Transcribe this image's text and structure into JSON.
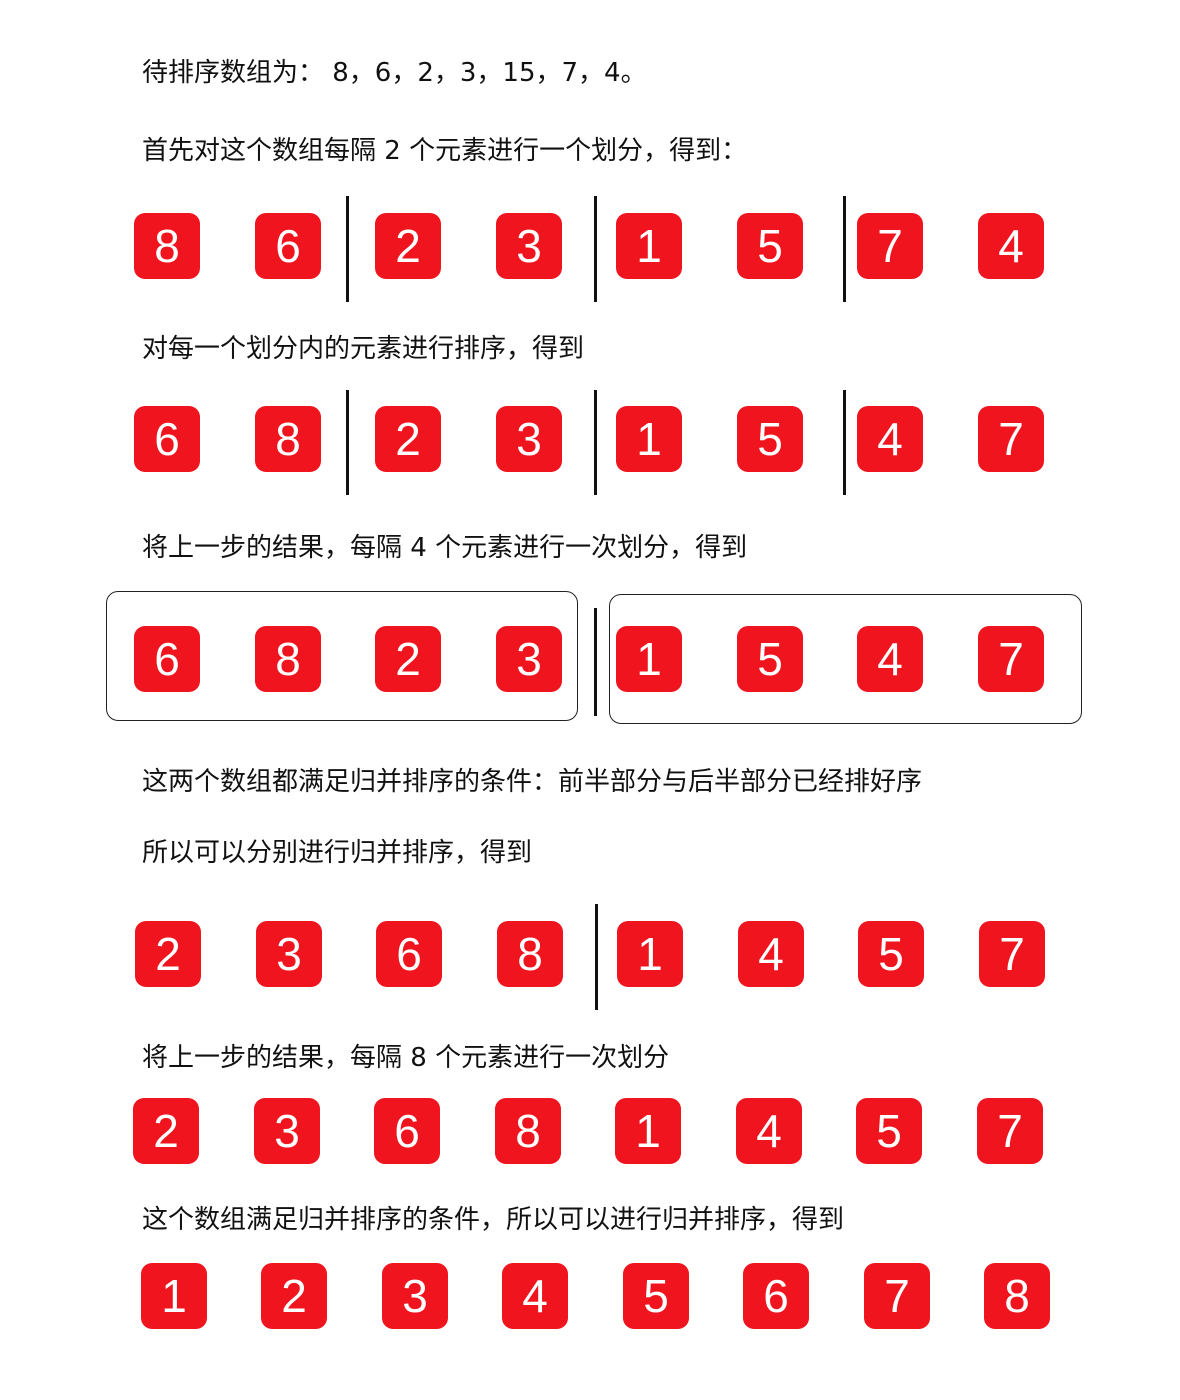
{
  "lines": {
    "intro": "待排序数组为： 8，6，2，3，15，7，4。",
    "step1": "首先对这个数组每隔 2 个元素进行一个划分，得到：",
    "step2": "对每一个划分内的元素进行排序，得到",
    "step3": "将上一步的结果，每隔 4 个元素进行一次划分，得到",
    "cond1": "这两个数组都满足归并排序的条件：前半部分与后半部分已经排好序",
    "step4": "所以可以分别进行归并排序，得到",
    "step5": "将上一步的结果，每隔 8 个元素进行一次划分",
    "step6": "这个数组满足归并排序的条件，所以可以进行归并排序，得到"
  },
  "rows": {
    "row1": [
      "8",
      "6",
      "2",
      "3",
      "1",
      "5",
      "7",
      "4"
    ],
    "row2": [
      "6",
      "8",
      "2",
      "3",
      "1",
      "5",
      "4",
      "7"
    ],
    "row3": [
      "6",
      "8",
      "2",
      "3",
      "1",
      "5",
      "4",
      "7"
    ],
    "row4": [
      "2",
      "3",
      "6",
      "8",
      "1",
      "4",
      "5",
      "7"
    ],
    "row5": [
      "2",
      "3",
      "6",
      "8",
      "1",
      "4",
      "5",
      "7"
    ],
    "row6": [
      "1",
      "2",
      "3",
      "4",
      "5",
      "6",
      "7",
      "8"
    ]
  },
  "colors": {
    "box": "#f0141e",
    "text": "#ffffff"
  }
}
